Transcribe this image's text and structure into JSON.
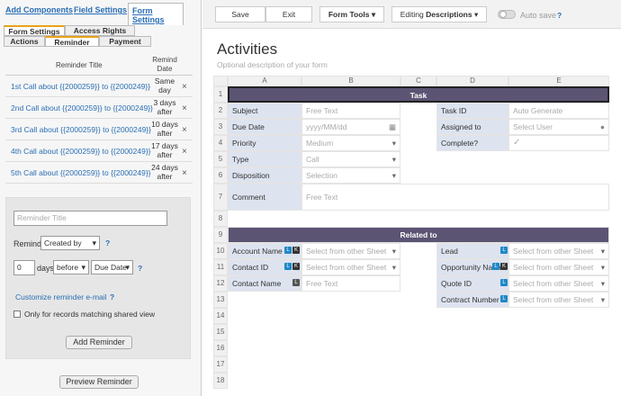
{
  "left": {
    "tabs": [
      "Add Components",
      "Field Settings",
      "Form Settings"
    ],
    "subtabs_row1": [
      "Form Settings",
      "Access Rights"
    ],
    "subtabs_row2": [
      "Actions",
      "Reminder",
      "Payment"
    ],
    "table_header": {
      "title": "Reminder Title",
      "date": "Remind Date"
    },
    "reminders": [
      {
        "title": "1st Call about {{2000259}} to {{2000249}}",
        "when": "Same day"
      },
      {
        "title": "2nd Call about {{2000259}} to {{2000249}}",
        "when": "3 days after"
      },
      {
        "title": "3rd Call about {{2000259}} to {{2000249}}",
        "when": "10 days after"
      },
      {
        "title": "4th Call about {{2000259}} to {{2000249}}",
        "when": "17 days after"
      },
      {
        "title": "5th Call about {{2000259}} to {{2000249}}",
        "when": "24 days after"
      }
    ],
    "remove_symbol": "×",
    "form": {
      "title_placeholder": "Reminder Title",
      "remind_label": "Remind",
      "remind_select": "Created by",
      "days_value": "0",
      "days_label": "days",
      "before_select": "before",
      "date_select": "Due Date",
      "help": "?",
      "customize_link": "Customize reminder e-mail",
      "only_label": "Only for records matching shared view",
      "add_button": "Add Reminder"
    },
    "preview_button": "Preview Reminder"
  },
  "toolbar": {
    "save": "Save",
    "exit": "Exit",
    "form_tools": "Form Tools",
    "editing_prefix": "Editing",
    "editing_value": "Descriptions",
    "autosave": "Auto save",
    "help": "?"
  },
  "form_title": "Activities",
  "form_desc": "Optional description of your form",
  "columns": [
    "A",
    "B",
    "C",
    "D",
    "E"
  ],
  "rows": [
    "1",
    "2",
    "3",
    "4",
    "5",
    "6",
    "7",
    "8",
    "9",
    "10",
    "11",
    "12",
    "13",
    "14",
    "15",
    "16",
    "17",
    "18"
  ],
  "sections": {
    "task": "Task",
    "related": "Related to"
  },
  "fields_left": [
    {
      "label": "Subject",
      "value": "Free Text"
    },
    {
      "label": "Due Date",
      "value": "yyyy/MM/dd"
    },
    {
      "label": "Priority",
      "value": "Medium"
    },
    {
      "label": "Type",
      "value": "Call"
    },
    {
      "label": "Disposition",
      "value": "Selection"
    },
    {
      "label": "Comment",
      "value": "Free Text"
    }
  ],
  "fields_right": [
    {
      "label": "Task ID",
      "value": "Auto Generate"
    },
    {
      "label": "Assigned to",
      "value": "Select User"
    },
    {
      "label": "Complete?",
      "value": "✓"
    }
  ],
  "related_left": [
    {
      "label": "Account Name",
      "value": "Select from other Sheet"
    },
    {
      "label": "Contact ID",
      "value": "Select from other Sheet"
    },
    {
      "label": "Contact Name",
      "value": "Free Text"
    }
  ],
  "related_right": [
    {
      "label": "Lead",
      "value": "Select from other Sheet"
    },
    {
      "label": "Opportunity Name",
      "value": "Select from other Sheet"
    },
    {
      "label": "Quote ID",
      "value": "Select from other Sheet"
    },
    {
      "label": "Contract Number",
      "value": "Select from other Sheet"
    }
  ],
  "badges": {
    "link": "L",
    "key": "K"
  },
  "colors": {
    "band": "#5c5473",
    "label_bg": "#dde3ef",
    "link": "#2a6fb5",
    "tab_accent": "#e8a317"
  }
}
